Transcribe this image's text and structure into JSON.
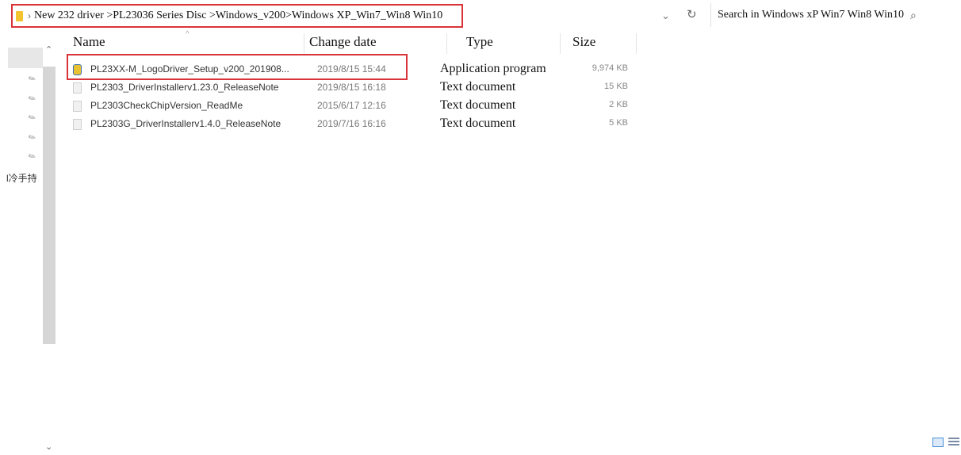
{
  "address": {
    "path": "New 232 driver >PL23036 Series Disc >Windows_v200>Windows XP_Win7_Win8 Win10",
    "chevron": "›",
    "dropdown_icon": "chevron-down-icon",
    "refresh_icon": "refresh-icon"
  },
  "search": {
    "placeholder": "Search in Windows xP Win7 Win8 Win10",
    "icon": "search-icon"
  },
  "nav": {
    "label": "l冷手持"
  },
  "columns": {
    "name": "Name",
    "date": "Change date",
    "type": "Type",
    "size": "Size"
  },
  "files": [
    {
      "name": "PL23XX-M_LogoDriver_Setup_v200_201908...",
      "date": "2019/8/15 15:44",
      "type": "Application program",
      "size": "9,974 KB",
      "icon": "app-icon"
    },
    {
      "name": "PL2303_DriverInstallerv1.23.0_ReleaseNote",
      "date": "2019/8/15 16:18",
      "type": "Text document",
      "size": "15 KB",
      "icon": "text-file-icon"
    },
    {
      "name": "PL2303CheckChipVersion_ReadMe",
      "date": "2015/6/17 12:16",
      "type": "Text document",
      "size": "2 KB",
      "icon": "text-file-icon"
    },
    {
      "name": "PL2303G_DriverInstallerv1.4.0_ReleaseNote",
      "date": "2019/7/16 16:16",
      "type": "Text document",
      "size": "5 KB",
      "icon": "text-file-icon"
    }
  ],
  "colors": {
    "highlight_border": "#d9343a",
    "folder": "#f4c430"
  }
}
